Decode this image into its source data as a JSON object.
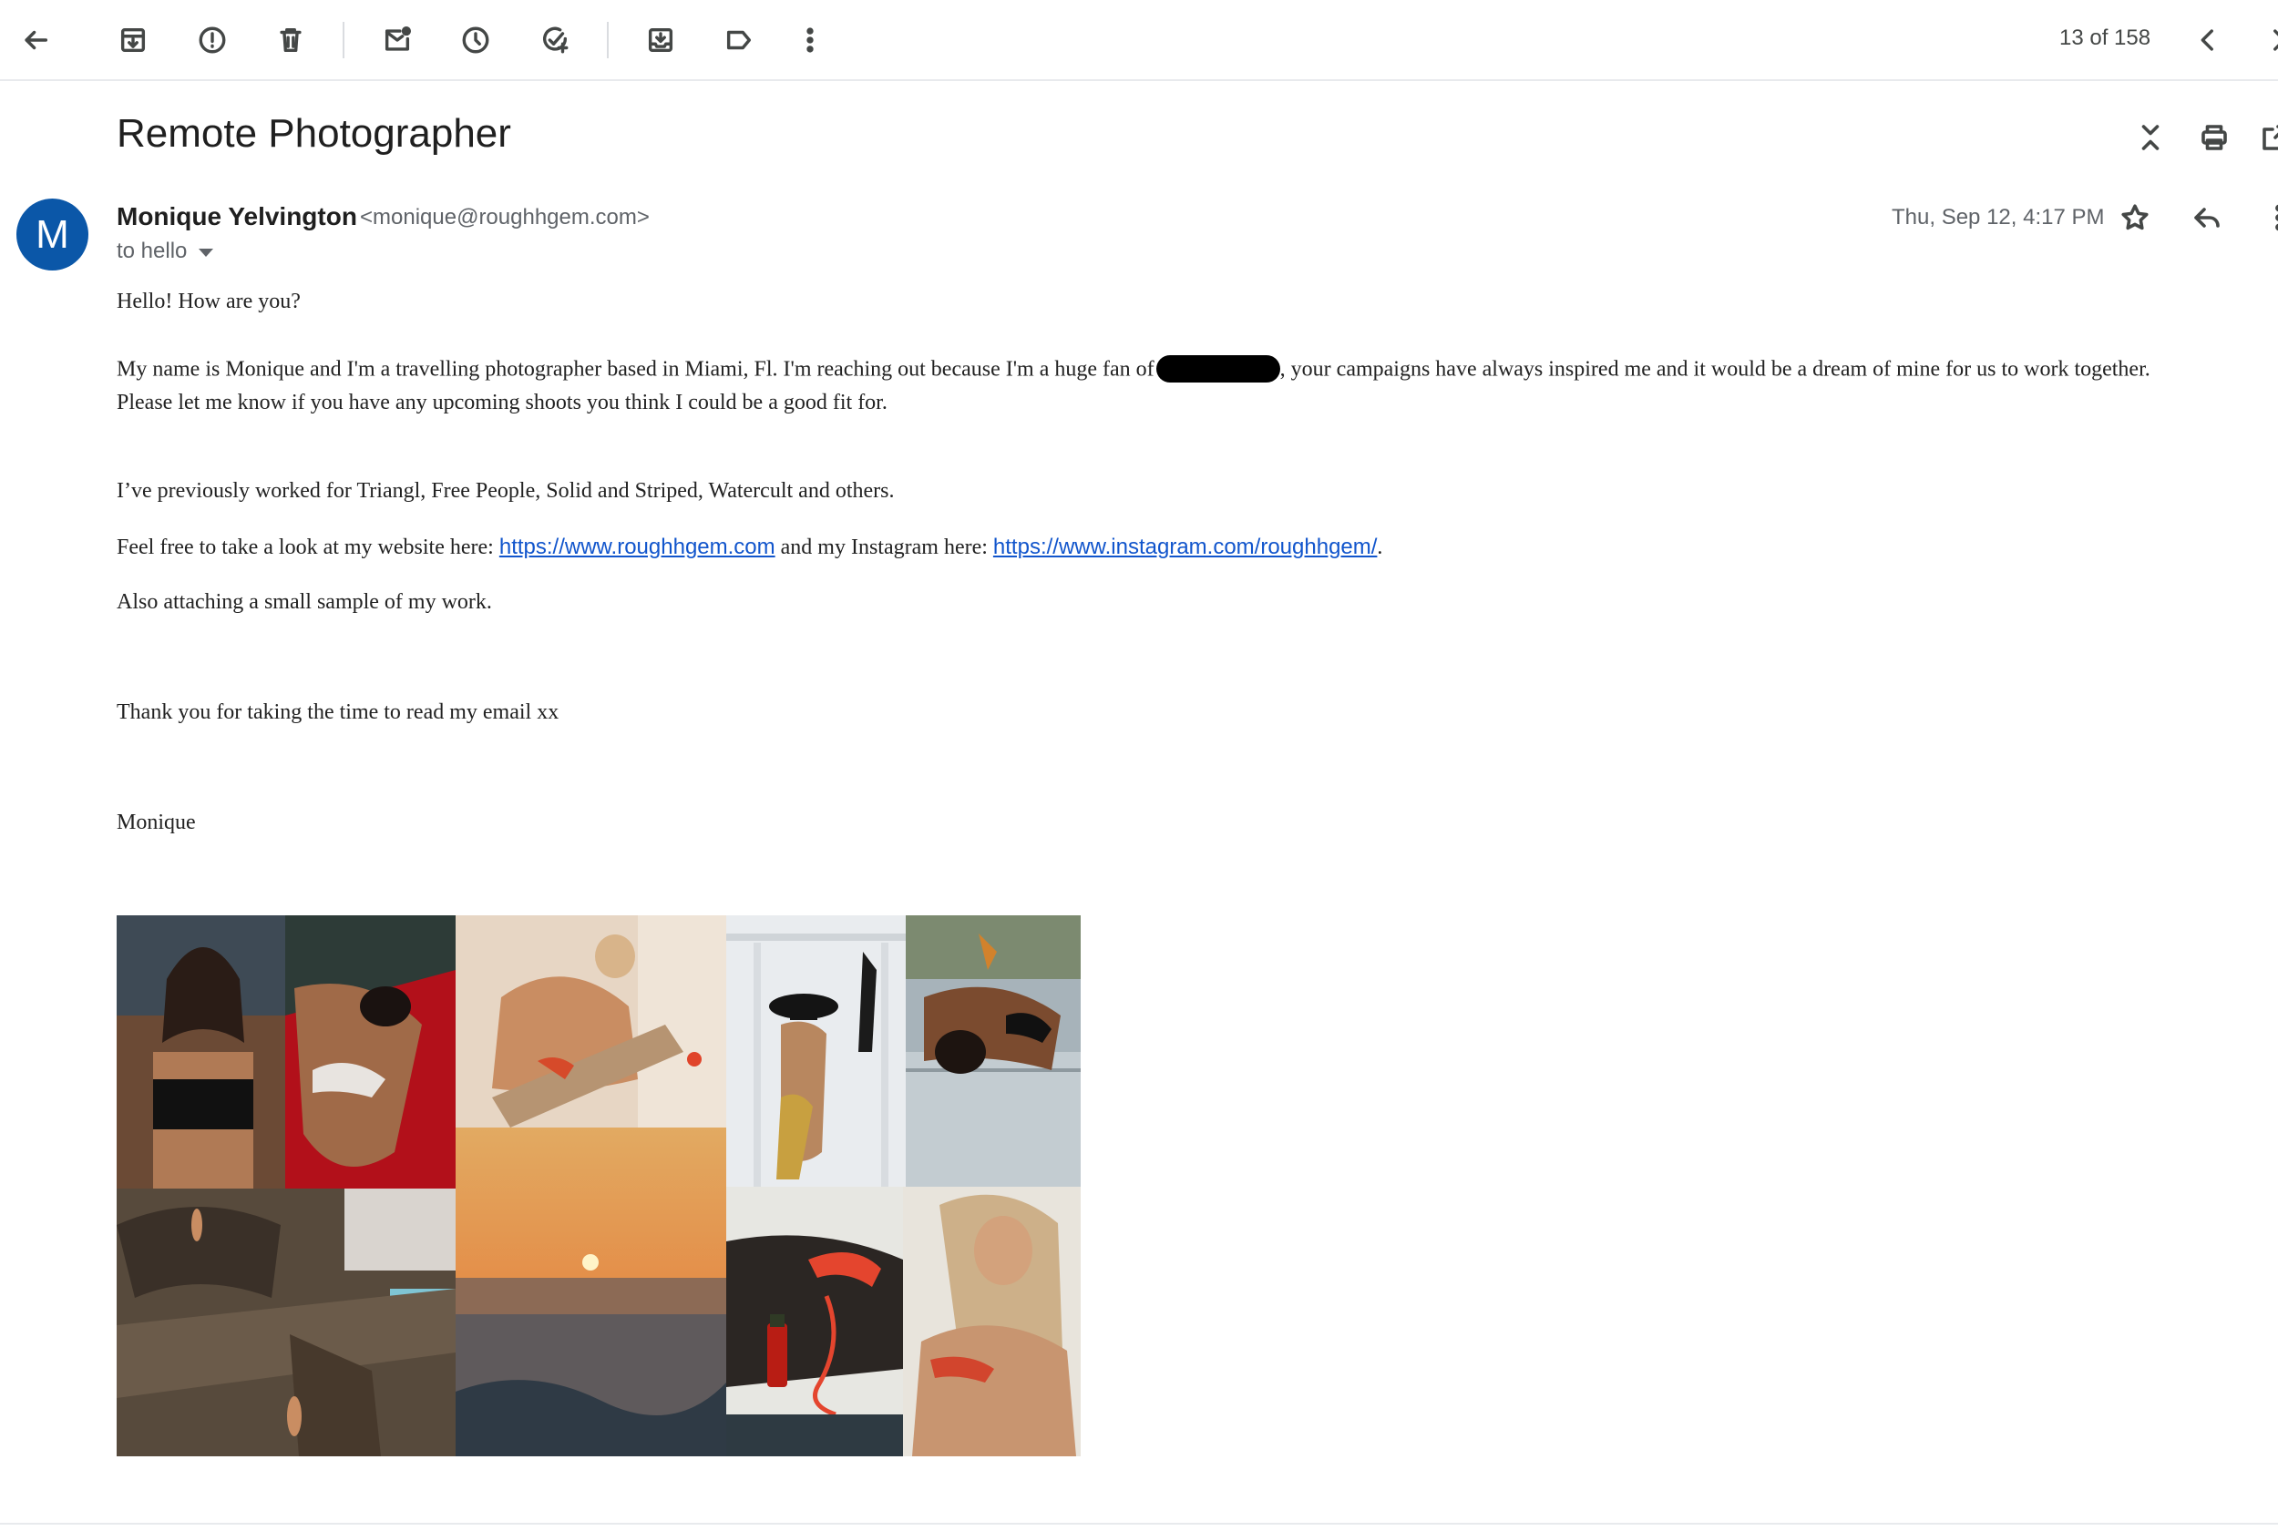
{
  "toolbar": {
    "back": "back-arrow-icon",
    "actions": [
      "archive-icon",
      "report-spam-icon",
      "delete-icon",
      "mark-unread-icon",
      "snooze-icon",
      "add-task-icon",
      "move-to-icon",
      "label-icon",
      "more-vert-icon"
    ],
    "pager": "13 of 158"
  },
  "email": {
    "subject": "Remote Photographer",
    "sender_name": "Monique Yelvington",
    "sender_email": "<monique@roughhgem.com>",
    "avatar_letter": "M",
    "to_line": "to hello",
    "date": "Thu, Sep 12, 4:17 PM",
    "body": {
      "greeting": "Hello! How are you?",
      "p1_before": "My name is Monique and I'm a travelling photographer based in Miami, Fl. I'm reaching out because I'm a huge fan of",
      "p1_after": ", your campaigns have always inspired me and it would be a dream of mine for us to work together.",
      "p1_line2": "Please let me know if you have any upcoming shoots you think I could be a good fit for.",
      "p2": "I’ve previously worked for Triangl, Free People, Solid and Striped, Watercult and others.",
      "p3_before": "Feel free to take a look at my website here: ",
      "website_link": "https://www.roughhgem.com",
      "p3_middle": " and my Instagram here: ",
      "instagram_link": "https://www.instagram.com/roughhgem/",
      "p3_after": ".",
      "p4": "Also attaching a small sample of my work.",
      "p5": "Thank you for taking the time to read my email xx",
      "signature": "Monique"
    }
  },
  "colors": {
    "avatar": "#0b57a8",
    "link": "#1155cc",
    "icon": "#444746"
  }
}
